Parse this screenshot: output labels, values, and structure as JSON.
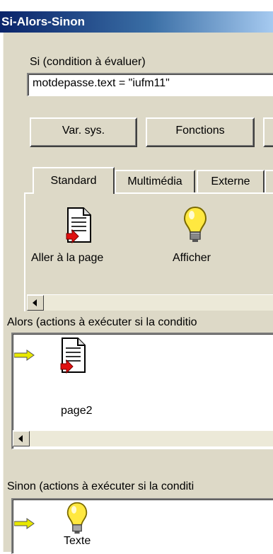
{
  "window": {
    "title": "Si-Alors-Sinon"
  },
  "condition": {
    "label": "Si (condition à évaluer)",
    "value": "motdepasse.text = \"iufm11\""
  },
  "buttons": {
    "var_sys": "Var. sys.",
    "fonctions": "Fonctions"
  },
  "tabs": [
    {
      "label": "Standard"
    },
    {
      "label": "Multimédia"
    },
    {
      "label": "Externe"
    }
  ],
  "palette": [
    {
      "label": "Aller à la page",
      "icon": "page-link-icon"
    },
    {
      "label": "Afficher",
      "icon": "lightbulb-icon"
    }
  ],
  "alors": {
    "label": "Alors (actions à exécuter si la conditio",
    "action_label": "page2",
    "action_icon": "page-link-icon"
  },
  "sinon": {
    "label": "Sinon (actions à exécuter si la conditi",
    "action_label": "Texte",
    "action_icon": "lightbulb-icon"
  },
  "colors": {
    "titlebar": "#0a246a",
    "face": "#ddd9c7",
    "arrow": "#e8e800"
  }
}
